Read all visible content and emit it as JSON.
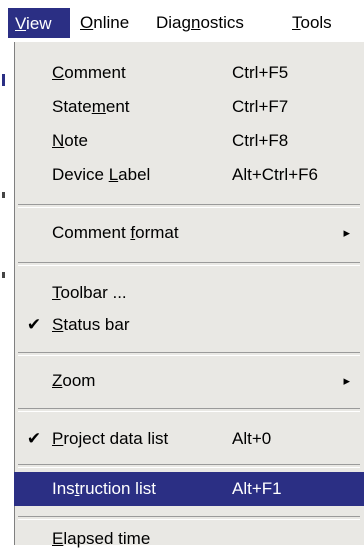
{
  "menubar": {
    "items": [
      {
        "label": "View",
        "mnemonic": "V",
        "rest": "iew",
        "active": true
      },
      {
        "label": "Online",
        "mnemonic": "O",
        "rest": "nline"
      },
      {
        "label": "Diagnostics",
        "pre": "Diag",
        "mnemonic": "n",
        "rest": "ostics"
      },
      {
        "label": "Tools",
        "mnemonic": "T",
        "rest": "ools"
      }
    ]
  },
  "menu": {
    "items": [
      {
        "pre": "",
        "mnemonic": "C",
        "post": "omment",
        "shortcut": "Ctrl+F5"
      },
      {
        "pre": "State",
        "mnemonic": "m",
        "post": "ent",
        "shortcut": "Ctrl+F7"
      },
      {
        "pre": "",
        "mnemonic": "N",
        "post": "ote",
        "shortcut": "Ctrl+F8"
      },
      {
        "pre": "Device ",
        "mnemonic": "L",
        "post": "abel",
        "shortcut": "Alt+Ctrl+F6"
      },
      {
        "pre": "Comment ",
        "mnemonic": "f",
        "post": "ormat",
        "submenu_arrow": "▸"
      },
      {
        "pre": "",
        "mnemonic": "T",
        "post": "oolbar ...",
        "shortcut": ""
      },
      {
        "pre": "",
        "mnemonic": "S",
        "post": "tatus bar",
        "checked": "✔"
      },
      {
        "pre": "",
        "mnemonic": "Z",
        "post": "oom",
        "submenu_arrow": "▸"
      },
      {
        "pre": "",
        "mnemonic": "P",
        "post": "roject data list",
        "shortcut": "Alt+0",
        "checked": "✔"
      },
      {
        "pre": "Ins",
        "mnemonic": "t",
        "post": "ruction list",
        "shortcut": "Alt+F1",
        "selected": true
      },
      {
        "pre": "",
        "mnemonic": "E",
        "post": "lapsed time",
        "shortcut": ""
      }
    ]
  },
  "colors": {
    "highlight": "#2b2f84",
    "menu_bg": "#e9e8e4"
  },
  "icons": {
    "check": "checkmark-icon",
    "submenu": "submenu-arrow-icon"
  }
}
